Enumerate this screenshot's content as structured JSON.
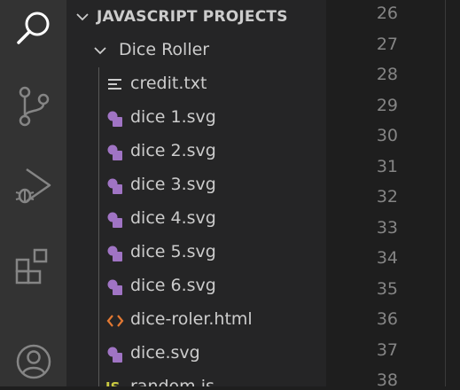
{
  "explorer": {
    "section_title": "JAVASCRIPT PROJECTS",
    "folder": {
      "name": "Dice Roller",
      "items": [
        {
          "label": "credit.txt",
          "icon": "text-file-icon"
        },
        {
          "label": "dice 1.svg",
          "icon": "svg-file-icon"
        },
        {
          "label": "dice 2.svg",
          "icon": "svg-file-icon"
        },
        {
          "label": "dice 3.svg",
          "icon": "svg-file-icon"
        },
        {
          "label": "dice 4.svg",
          "icon": "svg-file-icon"
        },
        {
          "label": "dice 5.svg",
          "icon": "svg-file-icon"
        },
        {
          "label": "dice 6.svg",
          "icon": "svg-file-icon"
        },
        {
          "label": "dice-roler.html",
          "icon": "html-file-icon"
        },
        {
          "label": "dice.svg",
          "icon": "svg-file-icon"
        },
        {
          "label": "random.js",
          "icon": "js-file-icon",
          "icon_text": "JS"
        }
      ]
    }
  },
  "editor": {
    "line_numbers": [
      "26",
      "27",
      "28",
      "29",
      "30",
      "31",
      "32",
      "33",
      "34",
      "35",
      "36",
      "37",
      "38"
    ]
  },
  "activity_bar": {
    "icons": [
      "search-icon",
      "source-control-icon",
      "run-debug-icon",
      "extensions-icon",
      "account-icon"
    ]
  },
  "colors": {
    "activity_bg": "#333333",
    "sidebar_bg": "#252526",
    "editor_bg": "#1e1e1e",
    "svg_icon": "#a074c4",
    "html_icon": "#e37933",
    "js_icon": "#cbcb41"
  }
}
